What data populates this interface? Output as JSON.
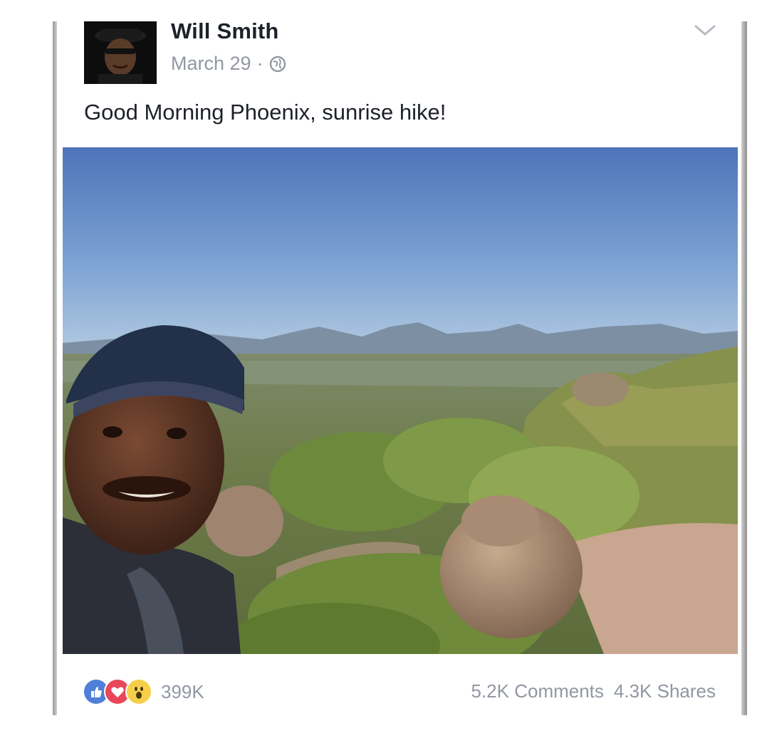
{
  "post": {
    "author": "Will Smith",
    "date": "March 29",
    "date_separator": "·",
    "text": "Good Morning Phoenix, sunrise hike!",
    "reaction_count": "399K",
    "comments": "5.2K Comments",
    "shares": "4.3K Shares"
  },
  "icons": {
    "privacy": "globe-icon",
    "menu": "chevron-down-icon",
    "reactions": [
      "like-icon",
      "love-icon",
      "wow-icon"
    ]
  },
  "colors": {
    "text_primary": "#1d2129",
    "text_secondary": "#9197a3",
    "like": "#4f7fd8",
    "love": "#e8475a",
    "wow": "#f6cf4a"
  }
}
